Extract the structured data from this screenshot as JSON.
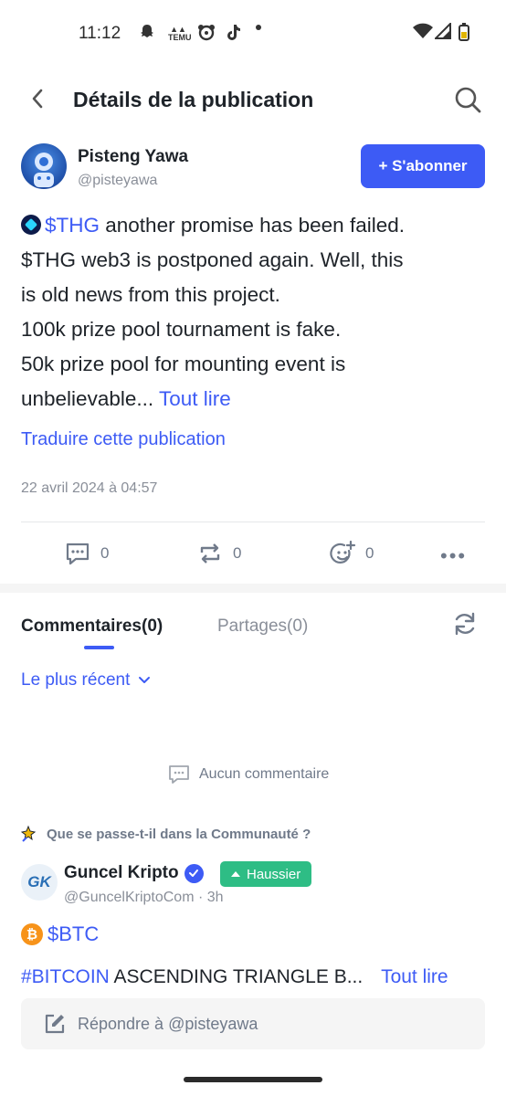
{
  "status_bar": {
    "time": "11:12",
    "app_icon_label": "TEMU"
  },
  "header": {
    "title": "Détails de la publication"
  },
  "author": {
    "name": "Pisteng Yawa",
    "handle": "@pisteyawa",
    "follow_label": "+ S'abonner"
  },
  "post": {
    "ticker": "$THG",
    "line1_rest": " another promise has been failed.",
    "line2": "$THG web3 is postponed again. Well, this",
    "line3": "is old news from this project.",
    "line4": "100k prize pool tournament is fake.",
    "line5": "50k prize pool for mounting event is",
    "line6": "unbelievable...",
    "read_more": "Tout lire",
    "translate": "Traduire cette publication",
    "date": "22 avril 2024 à 04:57"
  },
  "actions": {
    "comments": "0",
    "reposts": "0",
    "reactions": "0"
  },
  "tabs": {
    "comments": "Commentaires(0)",
    "shares": "Partages(0)"
  },
  "sort": {
    "label": "Le plus récent"
  },
  "empty": {
    "label": "Aucun commentaire"
  },
  "community": {
    "title": "Que se passe-t-il dans la Communauté ?",
    "post": {
      "avatar_text": "GK",
      "name": "Guncel Kripto",
      "badge": "Haussier",
      "handle": "@GuncelKriptoCom · 3h",
      "coin_symbol": "₿",
      "ticker": "$BTC",
      "hashtag": "#BITCOIN",
      "text_rest": " ASCENDING TRIANGLE B...",
      "read_more": "Tout lire"
    }
  },
  "reply": {
    "placeholder": "Répondre à @pisteyawa"
  },
  "colors": {
    "accent": "#3d5bf5",
    "bullish": "#2ebd85",
    "muted": "#707a8a"
  }
}
